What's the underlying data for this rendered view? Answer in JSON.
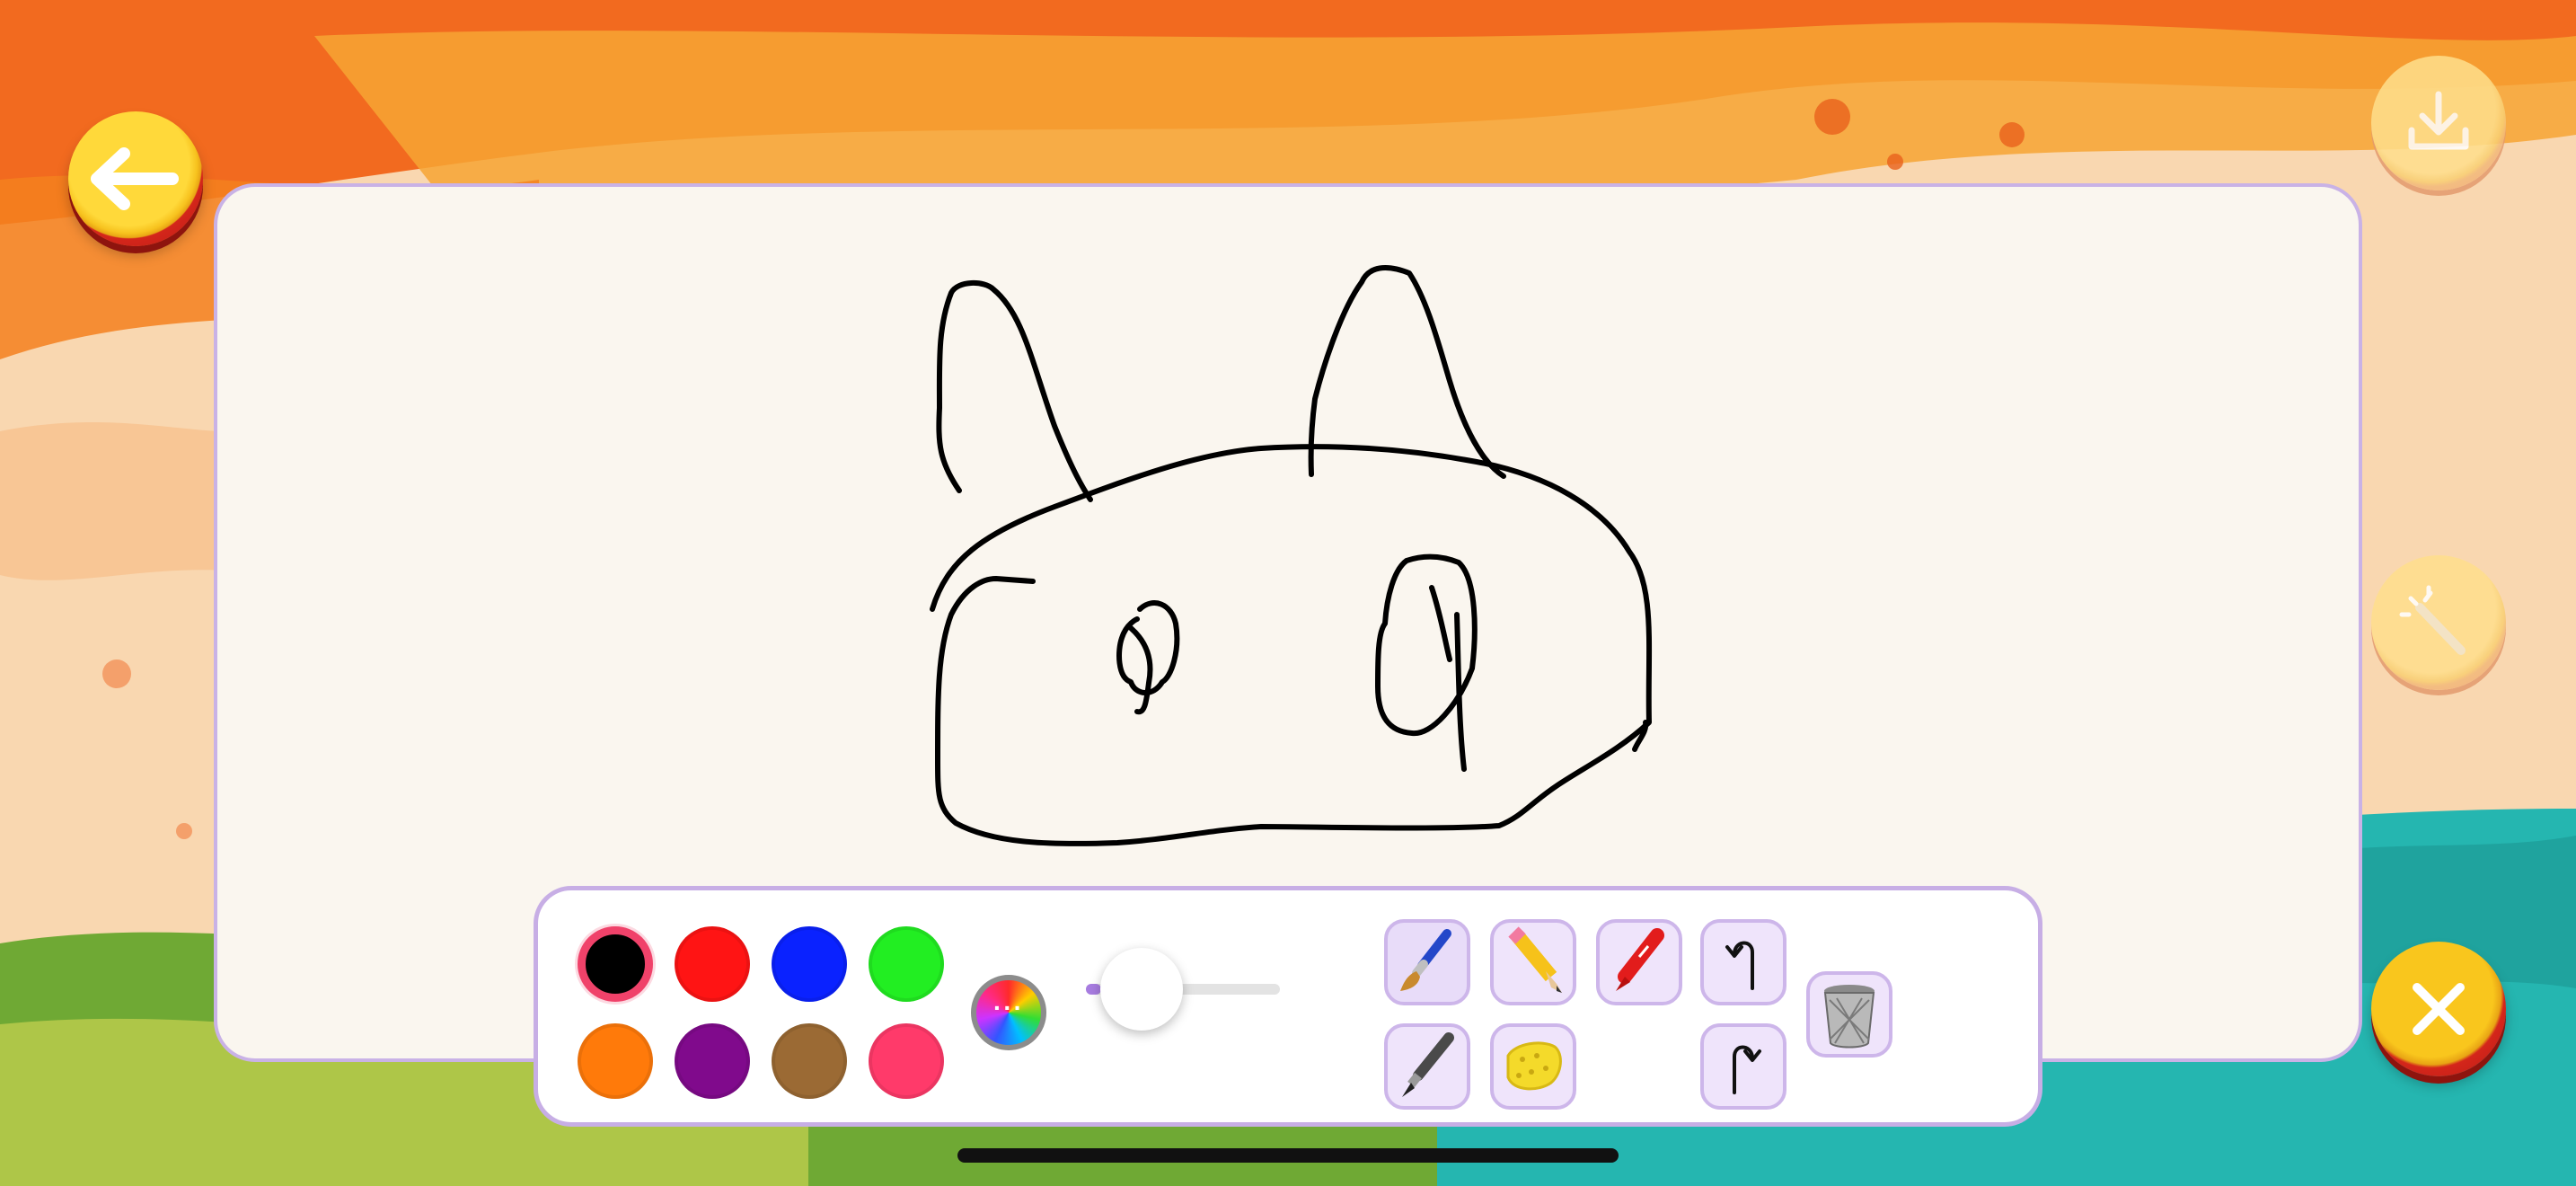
{
  "app": {
    "screen": "drawing-board",
    "accent_color": "#c7aee5"
  },
  "top_left": {
    "back_icon": "arrow-left-icon"
  },
  "top_right": {
    "download_icon": "download-icon",
    "magic_icon": "magic-wand-icon"
  },
  "bottom_right": {
    "close_icon": "close-icon"
  },
  "canvas": {
    "background": "#faf6ef",
    "drawing_color": "#000000"
  },
  "toolbar": {
    "colors": [
      {
        "name": "black",
        "hex": "#000000",
        "selected": true
      },
      {
        "name": "red",
        "hex": "#ff1414",
        "selected": false
      },
      {
        "name": "blue",
        "hex": "#0a22ff",
        "selected": false
      },
      {
        "name": "green",
        "hex": "#22ee22",
        "selected": false
      },
      {
        "name": "orange",
        "hex": "#ff7a0a",
        "selected": false
      },
      {
        "name": "purple",
        "hex": "#800a8c",
        "selected": false
      },
      {
        "name": "brown",
        "hex": "#9b6a34",
        "selected": false
      },
      {
        "name": "pink",
        "hex": "#ff3a6a",
        "selected": false
      }
    ],
    "color_picker_icon": "color-wheel-icon",
    "brush_size": 0.08,
    "tools": [
      {
        "name": "brush",
        "icon": "paintbrush-icon"
      },
      {
        "name": "pencil",
        "icon": "pencil-icon"
      },
      {
        "name": "crayon",
        "icon": "crayon-icon"
      },
      {
        "name": "pen",
        "icon": "pen-icon"
      },
      {
        "name": "sponge",
        "icon": "sponge-icon"
      }
    ],
    "undo_icon": "undo-icon",
    "redo_icon": "redo-icon",
    "trash_icon": "trash-icon"
  }
}
